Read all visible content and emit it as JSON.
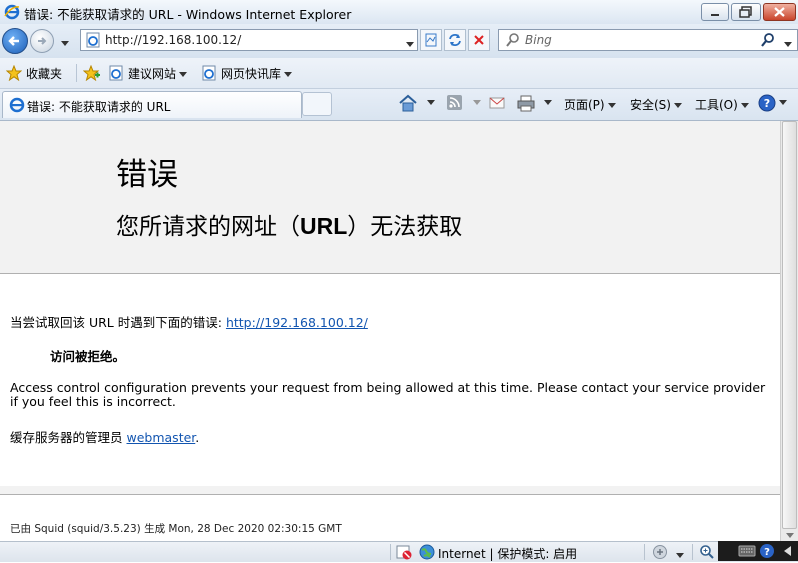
{
  "window": {
    "title": "错误: 不能获取请求的 URL - Windows Internet Explorer",
    "minimize_icon": "minimize-icon",
    "maximize_icon": "maximize-icon",
    "close_icon": "close-icon"
  },
  "navigation": {
    "address": "http://192.168.100.12/",
    "search_placeholder": "Bing"
  },
  "favorites_bar": {
    "favorites_label": "收藏夹",
    "items": [
      {
        "label": "建议网站"
      },
      {
        "label": "网页快讯库"
      }
    ]
  },
  "tab": {
    "label": "错误: 不能获取请求的 URL"
  },
  "command_bar": {
    "page_label": "页面(P)",
    "safety_label": "安全(S)",
    "tools_label": "工具(O)"
  },
  "page": {
    "heading": "错误",
    "subheading_pre": "您所请求的网址（",
    "subheading_bold": "URL",
    "subheading_post": "）无法获取",
    "attempt_text": "当尝试取回该 URL 时遇到下面的错误:",
    "attempt_url": "http://192.168.100.12/",
    "denied_text": "访问被拒绝。",
    "acl_line1": "Access control configuration prevents your request from being allowed at this time. Please contact your service provider",
    "acl_line2": "if you feel this is incorrect.",
    "admin_text": "缓存服务器的管理员",
    "admin_link": "webmaster",
    "admin_period": ".",
    "footer": "已由 Squid (squid/3.5.23) 生成 Mon, 28 Dec 2020 02:30:15 GMT"
  },
  "status_bar": {
    "zone": "Internet | 保护模式: 启用"
  }
}
